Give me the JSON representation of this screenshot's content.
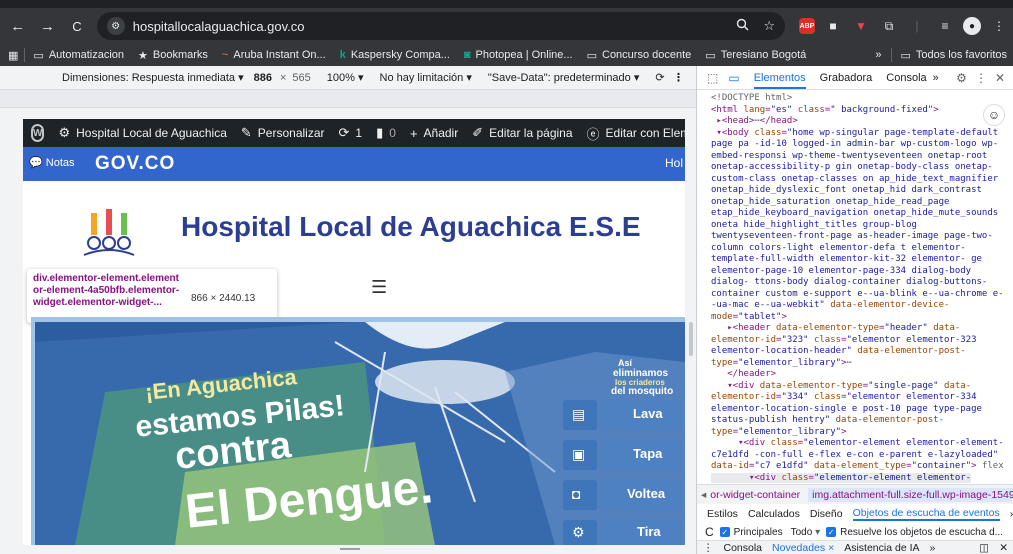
{
  "browser": {
    "back": "←",
    "forward": "→",
    "reload": "C",
    "site_icon": "⚙",
    "url": "hospitallocalaguachica.gov.co",
    "abp": "ABP"
  },
  "bookmarks": [
    {
      "icon": "▭",
      "label": "Automatizacion"
    },
    {
      "icon": "★",
      "label": "Bookmarks"
    },
    {
      "icon": "~",
      "label": "Aruba Instant On..."
    },
    {
      "icon": "k",
      "label": "Kaspersky Compa..."
    },
    {
      "icon": "◙",
      "label": "Photopea | Online..."
    },
    {
      "icon": "▭",
      "label": "Concurso docente"
    },
    {
      "icon": "▭",
      "label": "Teresiano Bogotá"
    }
  ],
  "bookmarks_more": "»",
  "bookmarks_all": "Todos los favoritos",
  "device_toolbar": {
    "dimensions": "Dimensiones: Respuesta inmediata ▾",
    "width": "886",
    "times": "×",
    "height": "565",
    "zoom": "100% ▾",
    "throttle": "No hay limitación ▾",
    "savedata": "\"Save-Data\": predeterminado ▾",
    "more": "⋮"
  },
  "wp_admin": {
    "site": "Hospital Local de Aguachica",
    "customize": "Personalizar",
    "updates": "1",
    "comments": "0",
    "add": "Añadir",
    "edit_page": "Editar la página",
    "elementor": "Editar con Element"
  },
  "gov": {
    "notas": "Notas",
    "govco": "GOV.CO",
    "hola": "Hol"
  },
  "hospital": {
    "title": "Hospital Local de Aguachica E.S.E"
  },
  "tooltip": {
    "selector": "div.elementor-element.elementor-element-4a50bfb.elementor-widget.elementor-widget-...",
    "size": "866 × 2440.13"
  },
  "banner": {
    "line1": "¡En Aguachica",
    "line2": "estamos Pilas!",
    "line3": "contra",
    "line4": "El Dengue.",
    "side_title1": "Así",
    "side_title2": "eliminamos",
    "side_title3": "los criaderos",
    "side_title4": "del mosquito",
    "lava": "Lava",
    "tapa": "Tapa",
    "voltea": "Voltea",
    "tira": "Tira"
  },
  "devtools": {
    "tabs": [
      "Elementos",
      "Grabadora",
      "Consola"
    ],
    "more": "»",
    "styles_tabs": [
      "Estilos",
      "Calculados",
      "Diseño",
      "Objetos de escucha de eventos"
    ],
    "styles_more": "»",
    "crumb1": "or-widget-container",
    "crumb2": "img.attachment-full.size-full.wp-image-1549",
    "filter_main": "Principales",
    "filter_all": "Todo",
    "filter_resolve": "Resuelve los objetos de escucha d...",
    "drawer": [
      "Consola",
      "Novedades ×",
      "Asistencia de IA"
    ],
    "drawer_more": "»",
    "a11y": "☺"
  }
}
